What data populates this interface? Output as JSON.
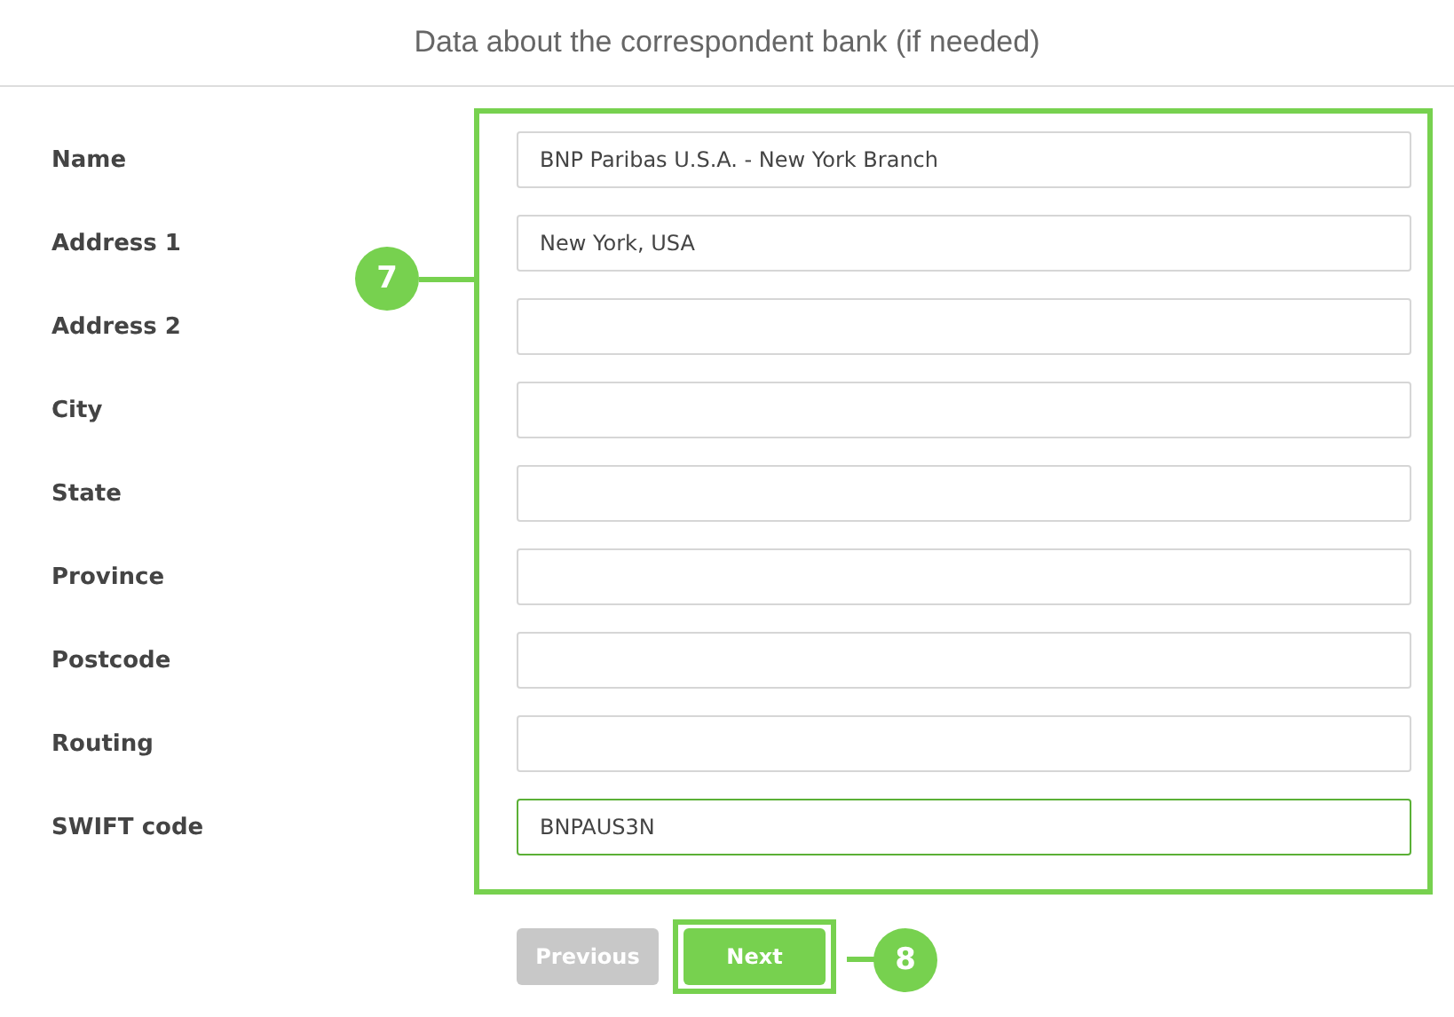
{
  "title": "Data about the correspondent bank (if needed)",
  "fields": [
    {
      "label": "Name",
      "value": "BNP Paribas U.S.A. - New York Branch",
      "focused": false
    },
    {
      "label": "Address 1",
      "value": "New York, USA",
      "focused": false
    },
    {
      "label": "Address 2",
      "focused": false
    },
    {
      "label": "City",
      "focused": false
    },
    {
      "label": "State",
      "focused": false
    },
    {
      "label": "Province",
      "focused": false
    },
    {
      "label": "Postcode",
      "focused": false
    },
    {
      "label": "Routing",
      "focused": false
    },
    {
      "label": "SWIFT code",
      "value": "BNPAUS3N",
      "focused": true
    }
  ],
  "buttons": [
    {
      "label": "Previous",
      "disabled": true,
      "highlighted": false
    },
    {
      "label": "Next",
      "disabled": false,
      "highlighted": true
    }
  ],
  "callouts": [
    "7",
    "8"
  ]
}
